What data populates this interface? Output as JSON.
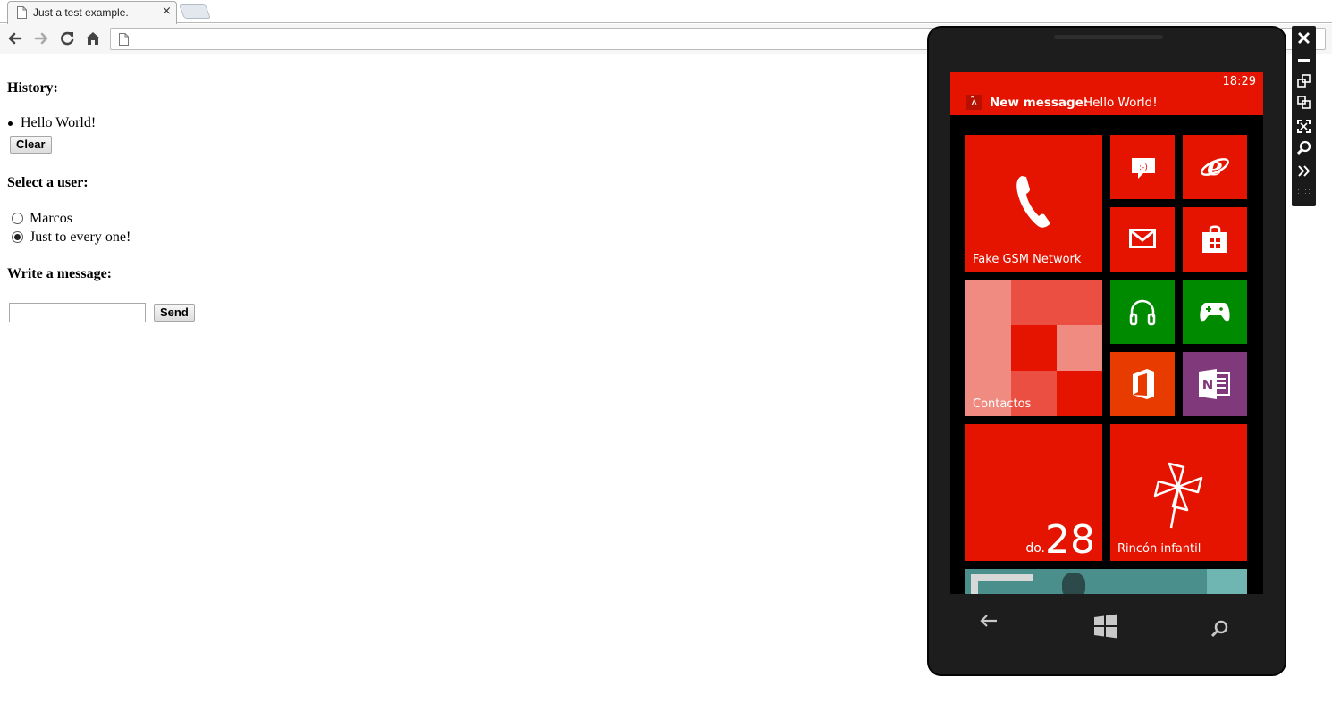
{
  "browser": {
    "tab_title": "Just a test example.",
    "tab_close": "×",
    "address_value": ""
  },
  "page": {
    "history_heading": "History:",
    "history_items": [
      "Hello World!"
    ],
    "clear_label": "Clear",
    "select_heading": "Select a user:",
    "users": [
      {
        "label": "Marcos",
        "checked": false
      },
      {
        "label": "Just to every one!",
        "checked": true
      }
    ],
    "write_heading": "Write a message:",
    "message_value": "",
    "send_label": "Send"
  },
  "phone": {
    "clock": "18:29",
    "notification_icon": "λ",
    "notification_title": "New message:",
    "notification_text": "Hello World!",
    "tiles": {
      "phone_label": "Fake GSM Network",
      "contacts_label": "Contactos",
      "calendar_weekday": "do.",
      "calendar_day": "28",
      "kids_label": "Rincón infantil"
    },
    "tile_icons": [
      "phone-icon",
      "messaging-icon",
      "internet-explorer-icon",
      "mail-icon",
      "store-icon",
      "music-icon",
      "xbox-games-icon",
      "office-icon",
      "onenote-icon",
      "pinwheel-icon"
    ],
    "hardware_buttons": [
      "back-icon",
      "windows-start-icon",
      "search-icon"
    ]
  },
  "emulator_toolbar": [
    "close-icon",
    "minimize-icon",
    "rotate-left-icon",
    "rotate-right-icon",
    "fit-to-screen-icon",
    "zoom-icon",
    "additional-tools-icon"
  ],
  "colors": {
    "accent_red": "#e51400",
    "green": "#008a00",
    "orange": "#e83b00",
    "purple": "#80397b"
  }
}
